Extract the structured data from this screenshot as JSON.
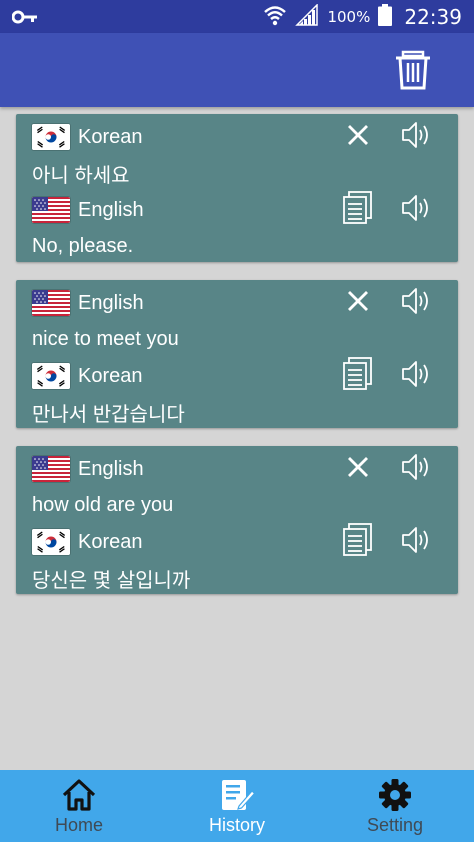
{
  "status_bar": {
    "battery": "100%",
    "time": "22:39",
    "icons": [
      "key-icon",
      "wifi-icon",
      "signal-icon",
      "battery-icon"
    ]
  },
  "app_bar": {
    "action_icon": "trash-icon"
  },
  "history": [
    {
      "source_lang": "Korean",
      "source_flag": "korea-flag",
      "source_text": "아니 하세요",
      "target_lang": "English",
      "target_flag": "us-flag",
      "target_text": "No, please."
    },
    {
      "source_lang": "English",
      "source_flag": "us-flag",
      "source_text": "nice to meet you",
      "target_lang": "Korean",
      "target_flag": "korea-flag",
      "target_text": "만나서 반갑습니다"
    },
    {
      "source_lang": "English",
      "source_flag": "us-flag",
      "source_text": "how old are you",
      "target_lang": "Korean",
      "target_flag": "korea-flag",
      "target_text": "당신은 몇 살입니까"
    }
  ],
  "bottom_nav": {
    "items": [
      {
        "label": "Home",
        "icon": "home-icon",
        "active": false
      },
      {
        "label": "History",
        "icon": "history-icon",
        "active": true
      },
      {
        "label": "Setting",
        "icon": "gear-icon",
        "active": false
      }
    ]
  },
  "colors": {
    "status_bar": "#2e3c9e",
    "app_bar": "#3f51b5",
    "card": "#588587",
    "background": "#d5d5d5",
    "bottom_nav": "#41a7ea"
  }
}
